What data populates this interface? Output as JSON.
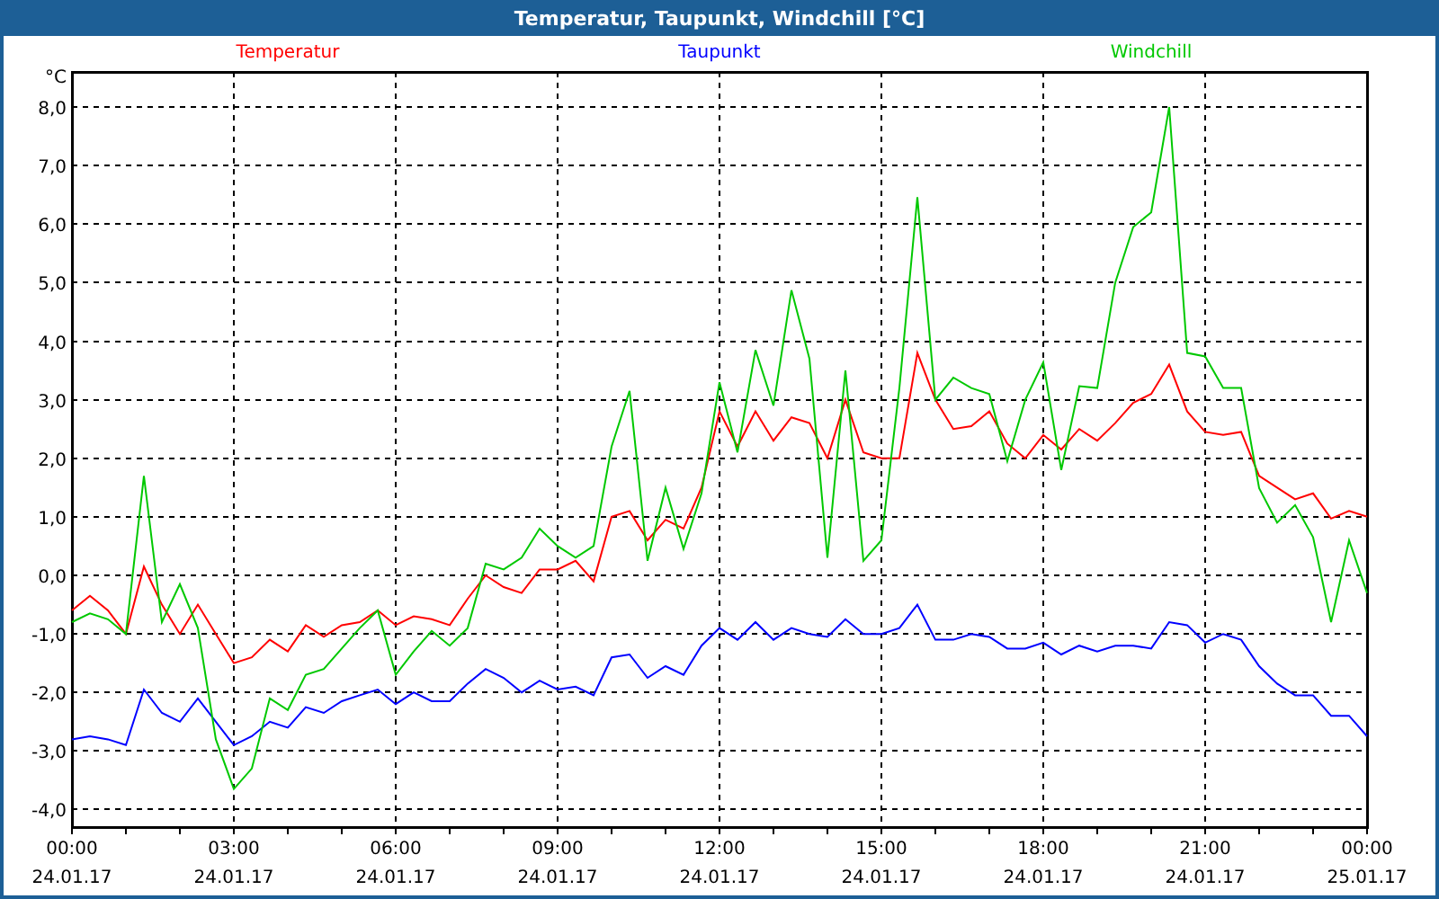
{
  "window": {
    "title": "Temperatur, Taupunkt, Windchill [°C]"
  },
  "chart_data": {
    "type": "line",
    "ylabel": "°C",
    "categories": [
      "00:00\n24.01.17",
      null,
      null,
      null,
      null,
      null,
      null,
      null,
      null,
      "03:00\n24.01.17",
      null,
      null,
      null,
      null,
      null,
      null,
      null,
      null,
      "06:00\n24.01.17",
      null,
      null,
      null,
      null,
      null,
      null,
      null,
      null,
      "09:00\n24.01.17",
      null,
      null,
      null,
      null,
      null,
      null,
      null,
      null,
      "12:00\n24.01.17",
      null,
      null,
      null,
      null,
      null,
      null,
      null,
      null,
      "15:00\n24.01.17",
      null,
      null,
      null,
      null,
      null,
      null,
      null,
      null,
      "18:00\n24.01.17",
      null,
      null,
      null,
      null,
      null,
      null,
      null,
      null,
      "21:00\n24.01.17",
      null,
      null,
      null,
      null,
      null,
      null,
      null,
      null,
      "00:00\n25.01.17"
    ],
    "series": [
      {
        "name": "Temperatur",
        "color": "#ff0000",
        "values": [
          -0.6,
          -0.35,
          -0.6,
          -1.0,
          0.15,
          -0.5,
          -1.0,
          -0.5,
          -1.0,
          -1.5,
          -1.4,
          -1.1,
          -1.3,
          -0.85,
          -1.05,
          -0.85,
          -0.8,
          -0.6,
          -0.85,
          -0.7,
          -0.75,
          -0.85,
          -0.4,
          0.0,
          -0.2,
          -0.3,
          0.1,
          0.1,
          0.25,
          -0.1,
          1.0,
          1.1,
          0.6,
          0.95,
          0.8,
          1.5,
          2.8,
          2.2,
          2.8,
          2.3,
          2.7,
          2.6,
          2.0,
          3.0,
          2.1,
          2.0,
          2.0,
          3.8,
          3.0,
          2.5,
          2.55,
          2.8,
          2.25,
          2.0,
          2.4,
          2.15,
          2.5,
          2.3,
          2.6,
          2.95,
          3.1,
          3.6,
          2.8,
          2.45,
          2.4,
          2.45,
          1.7,
          1.5,
          1.3,
          1.4,
          0.97,
          1.1,
          1.0
        ]
      },
      {
        "name": "Taupunkt",
        "color": "#0000ff",
        "values": [
          -2.8,
          -2.75,
          -2.8,
          -2.9,
          -1.95,
          -2.35,
          -2.5,
          -2.1,
          -2.5,
          -2.9,
          -2.75,
          -2.5,
          -2.6,
          -2.25,
          -2.35,
          -2.15,
          -2.05,
          -1.95,
          -2.2,
          -2.0,
          -2.15,
          -2.15,
          -1.85,
          -1.6,
          -1.75,
          -2.0,
          -1.8,
          -1.95,
          -1.9,
          -2.05,
          -1.4,
          -1.35,
          -1.75,
          -1.55,
          -1.7,
          -1.2,
          -0.9,
          -1.1,
          -0.8,
          -1.1,
          -0.9,
          -1.0,
          -1.05,
          -0.75,
          -1.0,
          -1.0,
          -0.9,
          -0.5,
          -1.1,
          -1.1,
          -1.0,
          -1.05,
          -1.25,
          -1.25,
          -1.15,
          -1.35,
          -1.2,
          -1.3,
          -1.2,
          -1.2,
          -1.25,
          -0.8,
          -0.85,
          -1.15,
          -1.0,
          -1.1,
          -1.55,
          -1.85,
          -2.05,
          -2.05,
          -2.4,
          -2.4,
          -2.75
        ]
      },
      {
        "name": "Windchill",
        "color": "#00c800",
        "values": [
          -0.8,
          -0.65,
          -0.75,
          -1.0,
          1.7,
          -0.8,
          -0.15,
          -0.9,
          -2.8,
          -3.65,
          -3.3,
          -2.1,
          -2.3,
          -1.7,
          -1.6,
          -1.25,
          -0.9,
          -0.6,
          -1.7,
          -1.3,
          -0.95,
          -1.2,
          -0.9,
          0.2,
          0.1,
          0.3,
          0.8,
          0.5,
          0.3,
          0.5,
          2.2,
          3.15,
          0.25,
          1.5,
          0.45,
          1.4,
          3.3,
          2.1,
          3.85,
          2.9,
          4.87,
          3.7,
          0.3,
          3.5,
          0.25,
          0.6,
          3.2,
          6.46,
          3.0,
          3.38,
          3.2,
          3.1,
          1.95,
          3.0,
          3.64,
          1.8,
          3.23,
          3.2,
          5.0,
          5.95,
          6.2,
          8.0,
          3.8,
          3.74,
          3.2,
          3.2,
          1.49,
          0.9,
          1.2,
          0.65,
          -0.8,
          0.6,
          -0.3
        ]
      }
    ],
    "ylim": [
      -4.3,
      8.6
    ],
    "grid": true,
    "yticks": [
      {
        "value": 8,
        "label": "8,0"
      },
      {
        "value": 7,
        "label": "7,0"
      },
      {
        "value": 6,
        "label": "6,0"
      },
      {
        "value": 5,
        "label": "5,0"
      },
      {
        "value": 4,
        "label": "4,0"
      },
      {
        "value": 3,
        "label": "3,0"
      },
      {
        "value": 2,
        "label": "2,0"
      },
      {
        "value": 1,
        "label": "1,0"
      },
      {
        "value": 0,
        "label": "0,0"
      },
      {
        "value": -1,
        "label": "-1,0"
      },
      {
        "value": -2,
        "label": "-2,0"
      },
      {
        "value": -3,
        "label": "-3,0"
      },
      {
        "value": -4,
        "label": "-4,0"
      }
    ]
  }
}
